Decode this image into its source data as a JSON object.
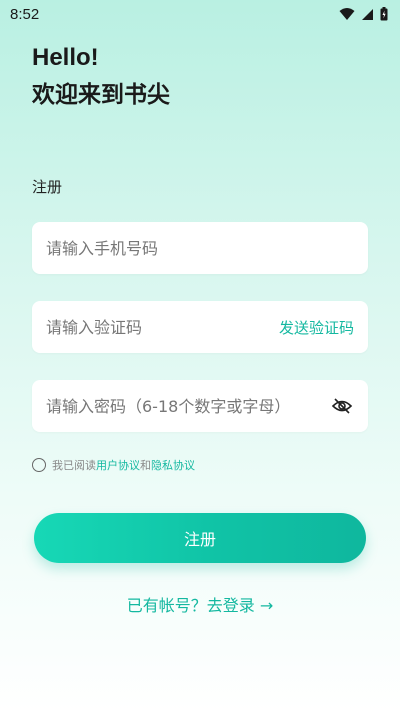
{
  "status_bar": {
    "time": "8:52",
    "icons": [
      "wifi-icon",
      "cell-signal-icon",
      "battery-icon"
    ]
  },
  "header": {
    "line1": "Hello!",
    "line2": "欢迎来到书尖"
  },
  "form": {
    "section_title": "注册",
    "phone": {
      "value": "",
      "placeholder": "请输入手机号码"
    },
    "code": {
      "value": "",
      "placeholder": "请输入验证码",
      "send_label": "发送验证码"
    },
    "password": {
      "value": "",
      "placeholder": "请输入密码（6-18个数字或字母）",
      "toggle_icon": "eye-off-icon"
    }
  },
  "agreement": {
    "checked": false,
    "prefix": "我已阅读",
    "user_agreement": "用户协议",
    "and": "和",
    "privacy_agreement": "隐私协议"
  },
  "actions": {
    "register_label": "注册",
    "login_prompt": "已有帐号？去登录 →"
  },
  "colors": {
    "accent": "#14b8a0",
    "button_start": "#17d8b6",
    "button_end": "#0fb79e",
    "background_top": "#b9f0e2"
  }
}
